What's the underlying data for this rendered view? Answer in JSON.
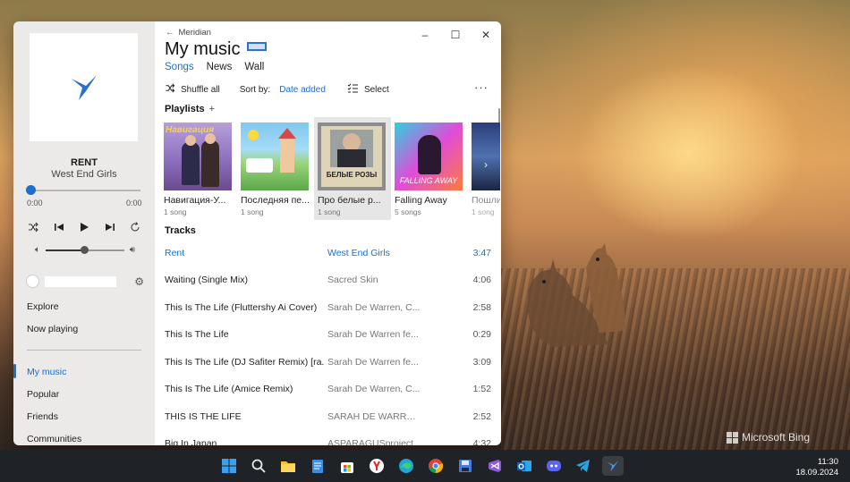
{
  "wallpaper": {
    "watermark": "Microsoft Bing"
  },
  "app": {
    "back_label": "Meridian",
    "title": "My music",
    "tabs": [
      {
        "label": "Songs",
        "active": true
      },
      {
        "label": "News",
        "active": false
      },
      {
        "label": "Wall",
        "active": false
      }
    ],
    "toolbar": {
      "shuffle_label": "Shuffle all",
      "sort_label": "Sort by:",
      "sort_value": "Date added",
      "select_label": "Select",
      "more_label": "···"
    },
    "playlists_heading": "Playlists",
    "playlists_add": "+",
    "playlists": [
      {
        "name": "Навигация-У...",
        "count": "1 song",
        "cover_text": "Навигация"
      },
      {
        "name": "Последняя пе...",
        "count": "1 song",
        "cover_text": ""
      },
      {
        "name": "Про белые р...",
        "count": "1 song",
        "cover_text": "БЕЛЫЕ РОЗЫ"
      },
      {
        "name": "Falling Away",
        "count": "5 songs",
        "cover_text": "FALLING AWAY"
      },
      {
        "name": "Пошли...",
        "count": "1 song",
        "cover_text": ""
      }
    ],
    "tracks_heading": "Tracks",
    "tracks": [
      {
        "title": "Rent",
        "artist": "West End Girls",
        "duration": "3:47",
        "playing": true
      },
      {
        "title": "Waiting (Single Mix)",
        "artist": "Sacred Skin",
        "duration": "4:06"
      },
      {
        "title": "This Is The Life (Fluttershy Ai Cover)",
        "artist": "Sarah De Warren, C...",
        "duration": "2:58"
      },
      {
        "title": "This Is The Life",
        "artist": "Sarah De Warren fe...",
        "duration": "0:29"
      },
      {
        "title": "This Is The Life (DJ Safiter Remix) [ra...",
        "artist": "Sarah De Warren fe...",
        "duration": "3:09"
      },
      {
        "title": "This Is The Life (Amice Remix)",
        "artist": "Sarah De Warren, C...",
        "duration": "1:52"
      },
      {
        "title": "THIS IS THE LIFE",
        "artist": "SARAH DE WARREN...",
        "duration": "2:52"
      },
      {
        "title": "Big In Japan",
        "artist": "ASPARAGUSproject",
        "duration": "4:32"
      }
    ]
  },
  "now_playing": {
    "title": "RENT",
    "artist": "West End Girls",
    "elapsed": "0:00",
    "total": "0:00",
    "progress": 0,
    "volume": 0.5
  },
  "sidebar": {
    "items_top": [
      "Explore",
      "Now playing"
    ],
    "items_bottom": [
      {
        "label": "My music",
        "active": true
      },
      {
        "label": "Popular",
        "active": false
      },
      {
        "label": "Friends",
        "active": false
      },
      {
        "label": "Communities",
        "active": false
      }
    ]
  },
  "taskbar": {
    "icons": [
      "windows-start-icon",
      "search-icon",
      "file-explorer-icon",
      "notepad-icon",
      "microsoft-store-icon",
      "yandex-browser-icon",
      "edge-icon",
      "chrome-icon",
      "save-disk-icon",
      "visual-studio-icon",
      "outlook-icon",
      "discord-icon",
      "telegram-icon",
      "meridian-icon"
    ],
    "time": "11:30",
    "date": "18.09.2024"
  },
  "colors": {
    "accent": "#1a6fd1",
    "taskbar": "#1f2226"
  }
}
